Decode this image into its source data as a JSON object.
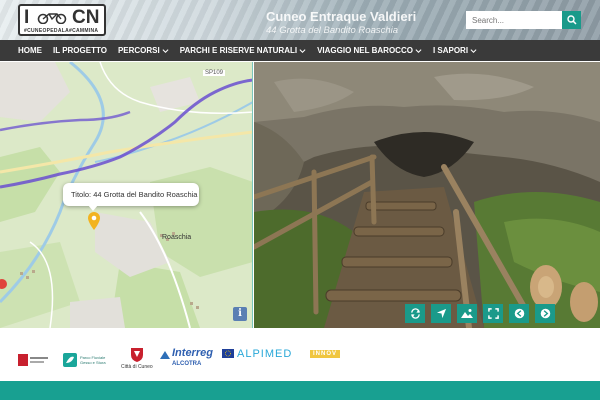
{
  "header": {
    "logo_text_left": "I",
    "logo_text_right": "CN",
    "logo_tagline": "#CUNEOPEDALA#CAMMINA",
    "title": "Cuneo Entraque Valdieri",
    "subtitle": "44 Grotta del Bandito Roaschia",
    "search_placeholder": "Search..."
  },
  "nav": {
    "items": [
      {
        "label": "HOME",
        "has_dropdown": false
      },
      {
        "label": "IL PROGETTO",
        "has_dropdown": false
      },
      {
        "label": "PERCORSI",
        "has_dropdown": true
      },
      {
        "label": "PARCHI E RISERVE NATURALI",
        "has_dropdown": true
      },
      {
        "label": "VIAGGIO NEL BAROCCO",
        "has_dropdown": true
      },
      {
        "label": "I SAPORI",
        "has_dropdown": true
      }
    ]
  },
  "map": {
    "popup_text": "Titolo: 44 Grotta del Bandito Roaschia",
    "labels": {
      "road": "SP109",
      "town": "Roaschia"
    },
    "info_button": "i"
  },
  "photo_controls": [
    {
      "icon": "refresh-icon"
    },
    {
      "icon": "navigate-icon"
    },
    {
      "icon": "landscape-icon"
    },
    {
      "icon": "fullscreen-icon"
    },
    {
      "icon": "previous-icon"
    },
    {
      "icon": "next-icon"
    }
  ],
  "partners": {
    "interreg": "Interreg",
    "alcotra": "ALCOTRA",
    "alpimed": "ALPIMED",
    "innov": "INNOV",
    "cuneo": "Città di Cuneo",
    "parco": "Parco Fluviale Gesso e Stura"
  },
  "colors": {
    "accent": "#1a9a8a",
    "nav_bg": "#3a3a3a",
    "footer": "#18a091",
    "route": "#6a4fd0"
  }
}
